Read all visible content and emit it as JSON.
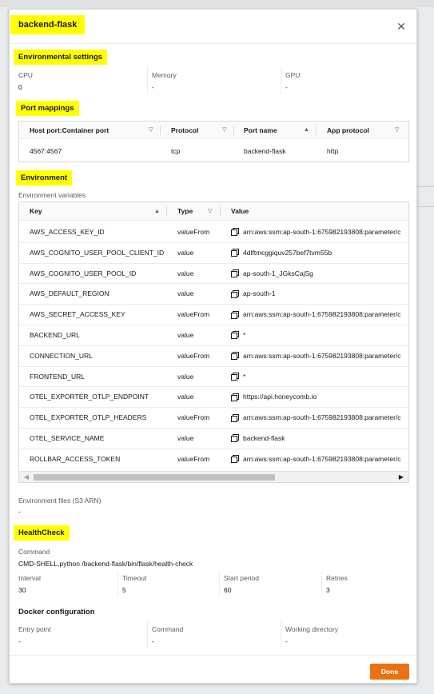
{
  "modal": {
    "title": "backend-flask",
    "done_label": "Done"
  },
  "env_settings": {
    "heading": "Environmental settings",
    "cpu_label": "CPU",
    "cpu_value": "0",
    "memory_label": "Memory",
    "memory_value": "-",
    "gpu_label": "GPU",
    "gpu_value": "-"
  },
  "port_mappings": {
    "heading": "Port mappings",
    "columns": [
      "Host port:Container port",
      "Protocol",
      "Port name",
      "App protocol"
    ],
    "rows": [
      {
        "port": "4567:4567",
        "protocol": "tcp",
        "name": "backend-flask",
        "app_protocol": "http"
      }
    ]
  },
  "environment": {
    "heading": "Environment",
    "subheading": "Environment variables",
    "columns": [
      "Key",
      "Type",
      "Value"
    ],
    "rows": [
      {
        "key": "AWS_ACCESS_KEY_ID",
        "type": "valueFrom",
        "value": "arn:aws:ssm:ap-south-1:675982193808:parameter/c"
      },
      {
        "key": "AWS_COGNITO_USER_POOL_CLIENT_ID",
        "type": "value",
        "value": "4dlftmcggiquv257bef7tvm55b"
      },
      {
        "key": "AWS_COGNITO_USER_POOL_ID",
        "type": "value",
        "value": "ap-south-1_JGksCajSg"
      },
      {
        "key": "AWS_DEFAULT_REGION",
        "type": "value",
        "value": "ap-south-1"
      },
      {
        "key": "AWS_SECRET_ACCESS_KEY",
        "type": "valueFrom",
        "value": "arn:aws:ssm:ap-south-1:675982193808:parameter/c"
      },
      {
        "key": "BACKEND_URL",
        "type": "value",
        "value": "*"
      },
      {
        "key": "CONNECTION_URL",
        "type": "valueFrom",
        "value": "arn:aws:ssm:ap-south-1:675982193808:parameter/c"
      },
      {
        "key": "FRONTEND_URL",
        "type": "value",
        "value": "*"
      },
      {
        "key": "OTEL_EXPORTER_OTLP_ENDPOINT",
        "type": "value",
        "value": "https://api.honeycomb.io"
      },
      {
        "key": "OTEL_EXPORTER_OTLP_HEADERS",
        "type": "valueFrom",
        "value": "arn:aws:ssm:ap-south-1:675982193808:parameter/c"
      },
      {
        "key": "OTEL_SERVICE_NAME",
        "type": "value",
        "value": "backend-flask"
      },
      {
        "key": "ROLLBAR_ACCESS_TOKEN",
        "type": "valueFrom",
        "value": "arn:aws:ssm:ap-south-1:675982193808:parameter/c"
      }
    ],
    "files_label": "Environment files (S3 ARN)",
    "files_value": "-"
  },
  "healthcheck": {
    "heading": "HealthCheck",
    "command_label": "Command",
    "command_value": "CMD-SHELL,python /backend-flask/bin/flask/health-check",
    "interval_label": "Interval",
    "interval_value": "30",
    "timeout_label": "Timeout",
    "timeout_value": "5",
    "start_label": "Start period",
    "start_value": "60",
    "retries_label": "Retries",
    "retries_value": "3"
  },
  "docker": {
    "heading": "Docker configuration",
    "entry_label": "Entry point",
    "entry_value": "-",
    "command_label": "Command",
    "command_value": "-",
    "workdir_label": "Working directory",
    "workdir_value": "-"
  }
}
